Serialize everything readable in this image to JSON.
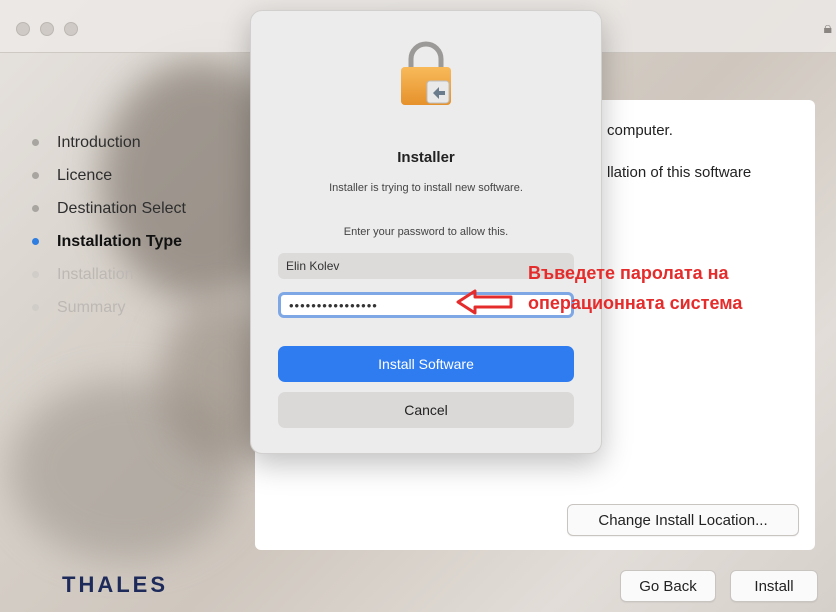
{
  "window": {
    "steps": [
      {
        "label": "Introduction",
        "state": "done"
      },
      {
        "label": "Licence",
        "state": "done"
      },
      {
        "label": "Destination Select",
        "state": "done"
      },
      {
        "label": "Installation Type",
        "state": "active"
      },
      {
        "label": "Installation",
        "state": "pending"
      },
      {
        "label": "Summary",
        "state": "pending"
      }
    ],
    "panel_line1": "computer.",
    "panel_line2": "llation of this software",
    "change_location_label": "Change Install Location...",
    "go_back_label": "Go Back",
    "install_label": "Install",
    "brand": "THALES"
  },
  "dialog": {
    "title": "Installer",
    "subtitle": "Installer is trying to install new software.",
    "prompt": "Enter your password to allow this.",
    "username": "Elin Kolev",
    "password_mask": "••••••••••••••••",
    "primary_label": "Install Software",
    "cancel_label": "Cancel"
  },
  "annotation": {
    "line1": "Въведете паролата на",
    "line2": "операционната система",
    "color": "#e52c2c"
  }
}
